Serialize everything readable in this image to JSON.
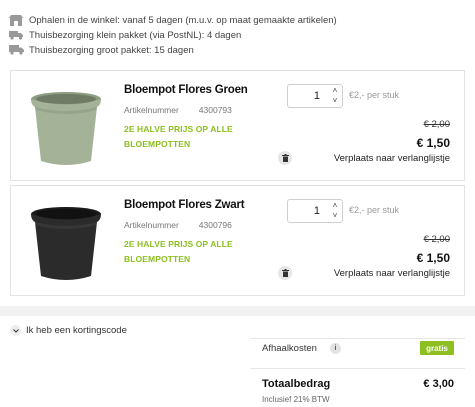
{
  "delivery": {
    "store": "Ophalen in de winkel: vanaf 5 dagen (m.u.v. op maat gemaakte artikelen)",
    "small": "Thuisbezorging klein pakket (via PostNL): 4 dagen",
    "large": "Thuisbezorging groot pakket: 15 dagen"
  },
  "items": [
    {
      "name": "Bloempot Flores Groen",
      "article_label": "Artikelnummer",
      "article_number": "4300793",
      "promo": "2E HALVE PRIJS OP ALLE BLOEMPOTTEN",
      "quantity": "1",
      "per_unit": "€2,- per stuk",
      "old_price": "€ 2,00",
      "new_price": "€ 1,50",
      "move_label": "Verplaats naar verlanglijstje",
      "pot_color": "#a4b298"
    },
    {
      "name": "Bloempot Flores Zwart",
      "article_label": "Artikelnummer",
      "article_number": "4300796",
      "promo": "2E HALVE PRIJS OP ALLE BLOEMPOTTEN",
      "quantity": "1",
      "per_unit": "€2,- per stuk",
      "old_price": "€ 2,00",
      "new_price": "€ 1,50",
      "move_label": "Verplaats naar verlanglijstje",
      "pot_color": "#2b2b2b"
    }
  ],
  "coupon": {
    "label": "Ik heb een kortingscode"
  },
  "summary": {
    "pickup_label": "Afhaalkosten",
    "info": "i",
    "pickup_value": "gratis",
    "total_label": "Totaalbedrag",
    "total_value": "€ 3,00",
    "vat_note": "Inclusief 21% BTW"
  },
  "colors": {
    "accent": "#8cbf1f"
  }
}
